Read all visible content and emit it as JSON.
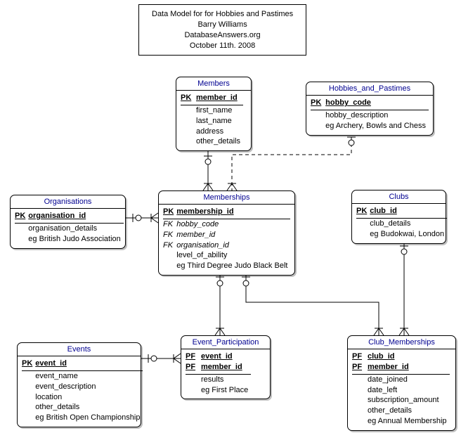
{
  "title": {
    "line1": "Data Model for for Hobbies and Pastimes",
    "line2": "Barry Williams",
    "line3": "DatabaseAnswers.org",
    "line4": "October 11th. 2008"
  },
  "entities": {
    "members": {
      "name": "Members",
      "rows": [
        {
          "key": "PK",
          "attr": "member_id",
          "pk": true
        },
        {
          "key": "",
          "attr": "first_name"
        },
        {
          "key": "",
          "attr": "last_name"
        },
        {
          "key": "",
          "attr": "address"
        },
        {
          "key": "",
          "attr": "other_details"
        }
      ]
    },
    "hobbies": {
      "name": "Hobbies_and_Pastimes",
      "rows": [
        {
          "key": "PK",
          "attr": "hobby_code",
          "pk": true
        },
        {
          "key": "",
          "attr": "hobby_description"
        },
        {
          "key": "",
          "attr": "eg Archery, Bowls and Chess"
        }
      ]
    },
    "organisations": {
      "name": "Organisations",
      "rows": [
        {
          "key": "PK",
          "attr": "organisation_id",
          "pk": true
        },
        {
          "key": "",
          "attr": "organisation_details"
        },
        {
          "key": "",
          "attr": "eg British Judo Association"
        }
      ]
    },
    "memberships": {
      "name": "Memberships",
      "rows": [
        {
          "key": "PK",
          "attr": "membership_id",
          "pk": true
        },
        {
          "key": "FK",
          "attr": "hobby_code",
          "fk": true
        },
        {
          "key": "FK",
          "attr": "member_id",
          "fk": true
        },
        {
          "key": "FK",
          "attr": "organisation_id",
          "fk": true
        },
        {
          "key": "",
          "attr": "level_of_ability"
        },
        {
          "key": "",
          "attr": "eg Third Degree Judo Black Belt"
        }
      ]
    },
    "clubs": {
      "name": "Clubs",
      "rows": [
        {
          "key": "PK",
          "attr": "club_id",
          "pk": true
        },
        {
          "key": "",
          "attr": "club_details"
        },
        {
          "key": "",
          "attr": "eg Budokwai, London"
        }
      ]
    },
    "events": {
      "name": "Events",
      "rows": [
        {
          "key": "PK",
          "attr": "event_id",
          "pk": true
        },
        {
          "key": "",
          "attr": "event_name"
        },
        {
          "key": "",
          "attr": "event_description"
        },
        {
          "key": "",
          "attr": "location"
        },
        {
          "key": "",
          "attr": "other_details"
        },
        {
          "key": "",
          "attr": "eg British Open Championship"
        }
      ]
    },
    "event_participation": {
      "name": "Event_Participation",
      "rows": [
        {
          "key": "PF",
          "attr": "event_id",
          "pk": true
        },
        {
          "key": "PF",
          "attr": "member_id",
          "pk": true
        },
        {
          "key": "",
          "attr": "results"
        },
        {
          "key": "",
          "attr": "eg First Place"
        }
      ]
    },
    "club_memberships": {
      "name": "Club_Memberships",
      "rows": [
        {
          "key": "PF",
          "attr": "club_id",
          "pk": true
        },
        {
          "key": "PF",
          "attr": "member_id",
          "pk": true
        },
        {
          "key": "",
          "attr": "date_joined"
        },
        {
          "key": "",
          "attr": "date_left"
        },
        {
          "key": "",
          "attr": "subscription_amount"
        },
        {
          "key": "",
          "attr": "other_details"
        },
        {
          "key": "",
          "attr": "eg Annual Membership"
        }
      ]
    }
  }
}
